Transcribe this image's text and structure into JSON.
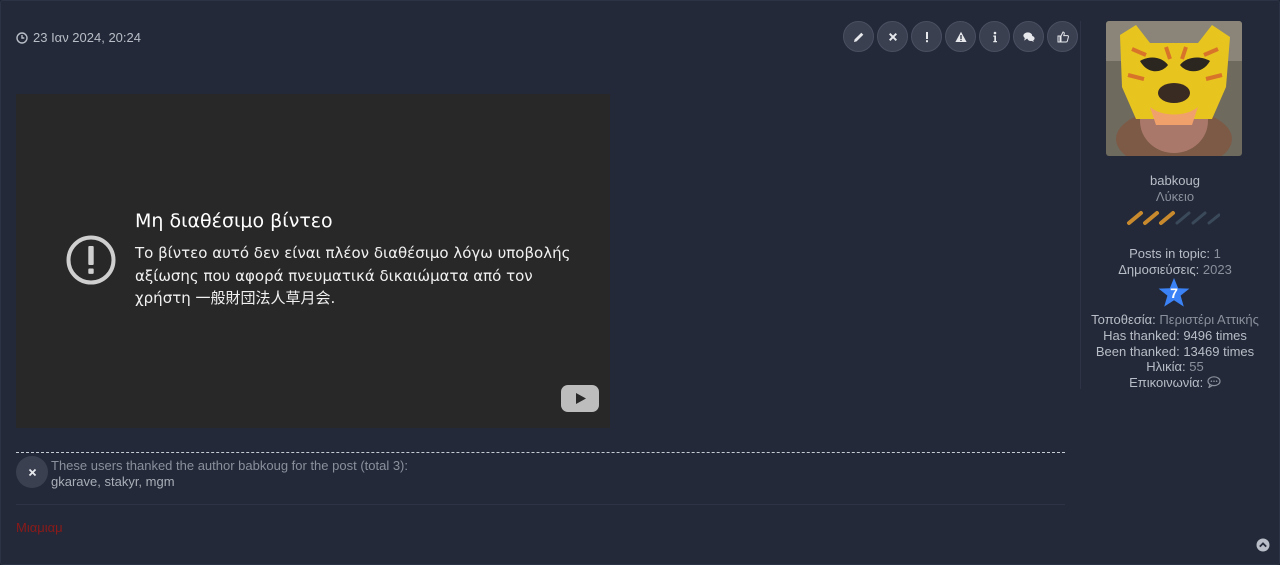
{
  "post": {
    "date": "23 Ιαν 2024, 20:24",
    "buttons": [
      {
        "name": "edit-button",
        "icon": "pencil-icon"
      },
      {
        "name": "delete-button",
        "icon": "close-icon"
      },
      {
        "name": "report-button",
        "icon": "exclamation-icon"
      },
      {
        "name": "warn-button",
        "icon": "warning-icon"
      },
      {
        "name": "info-button",
        "icon": "info-icon"
      },
      {
        "name": "quote-button",
        "icon": "comments-icon"
      },
      {
        "name": "thank-button",
        "icon": "thumbs-up-icon"
      }
    ]
  },
  "video": {
    "title": "Μη διαθέσιμο βίντεο",
    "message": "Το βίντεο αυτό δεν είναι πλέον διαθέσιμο λόγω υποβολής αξίωσης που αφορά πνευματικά δικαιώματα από τον χρήστη 一般財団法人草月会.",
    "logo_icon": "youtube-play-icon"
  },
  "thanks": {
    "text": "These users thanked the author babkoug for the post (total 3):",
    "names": "gkarave, stakyr, mgm"
  },
  "signature": {
    "text": "Μιαμιαμ"
  },
  "profile": {
    "username": "babkoug",
    "rank": "Λύκειο",
    "posts_in_topic_label": "Posts in topic:",
    "posts_in_topic": "1",
    "posts_label": "Δημοσιεύσεις:",
    "posts": "2023",
    "badge_number": "7",
    "location_label": "Τοποθεσία:",
    "location": "Περιστέρι Αττικής",
    "has_thanked_label": "Has thanked:",
    "has_thanked": "9496 times",
    "been_thanked_label": "Been thanked:",
    "been_thanked": "13469 times",
    "age_label": "Ηλικία:",
    "age": "55",
    "contact_label": "Επικοινωνία:"
  },
  "colors": {
    "background": "#232938",
    "accent_star": "#3b82f6",
    "signature": "#8b1a1a"
  }
}
